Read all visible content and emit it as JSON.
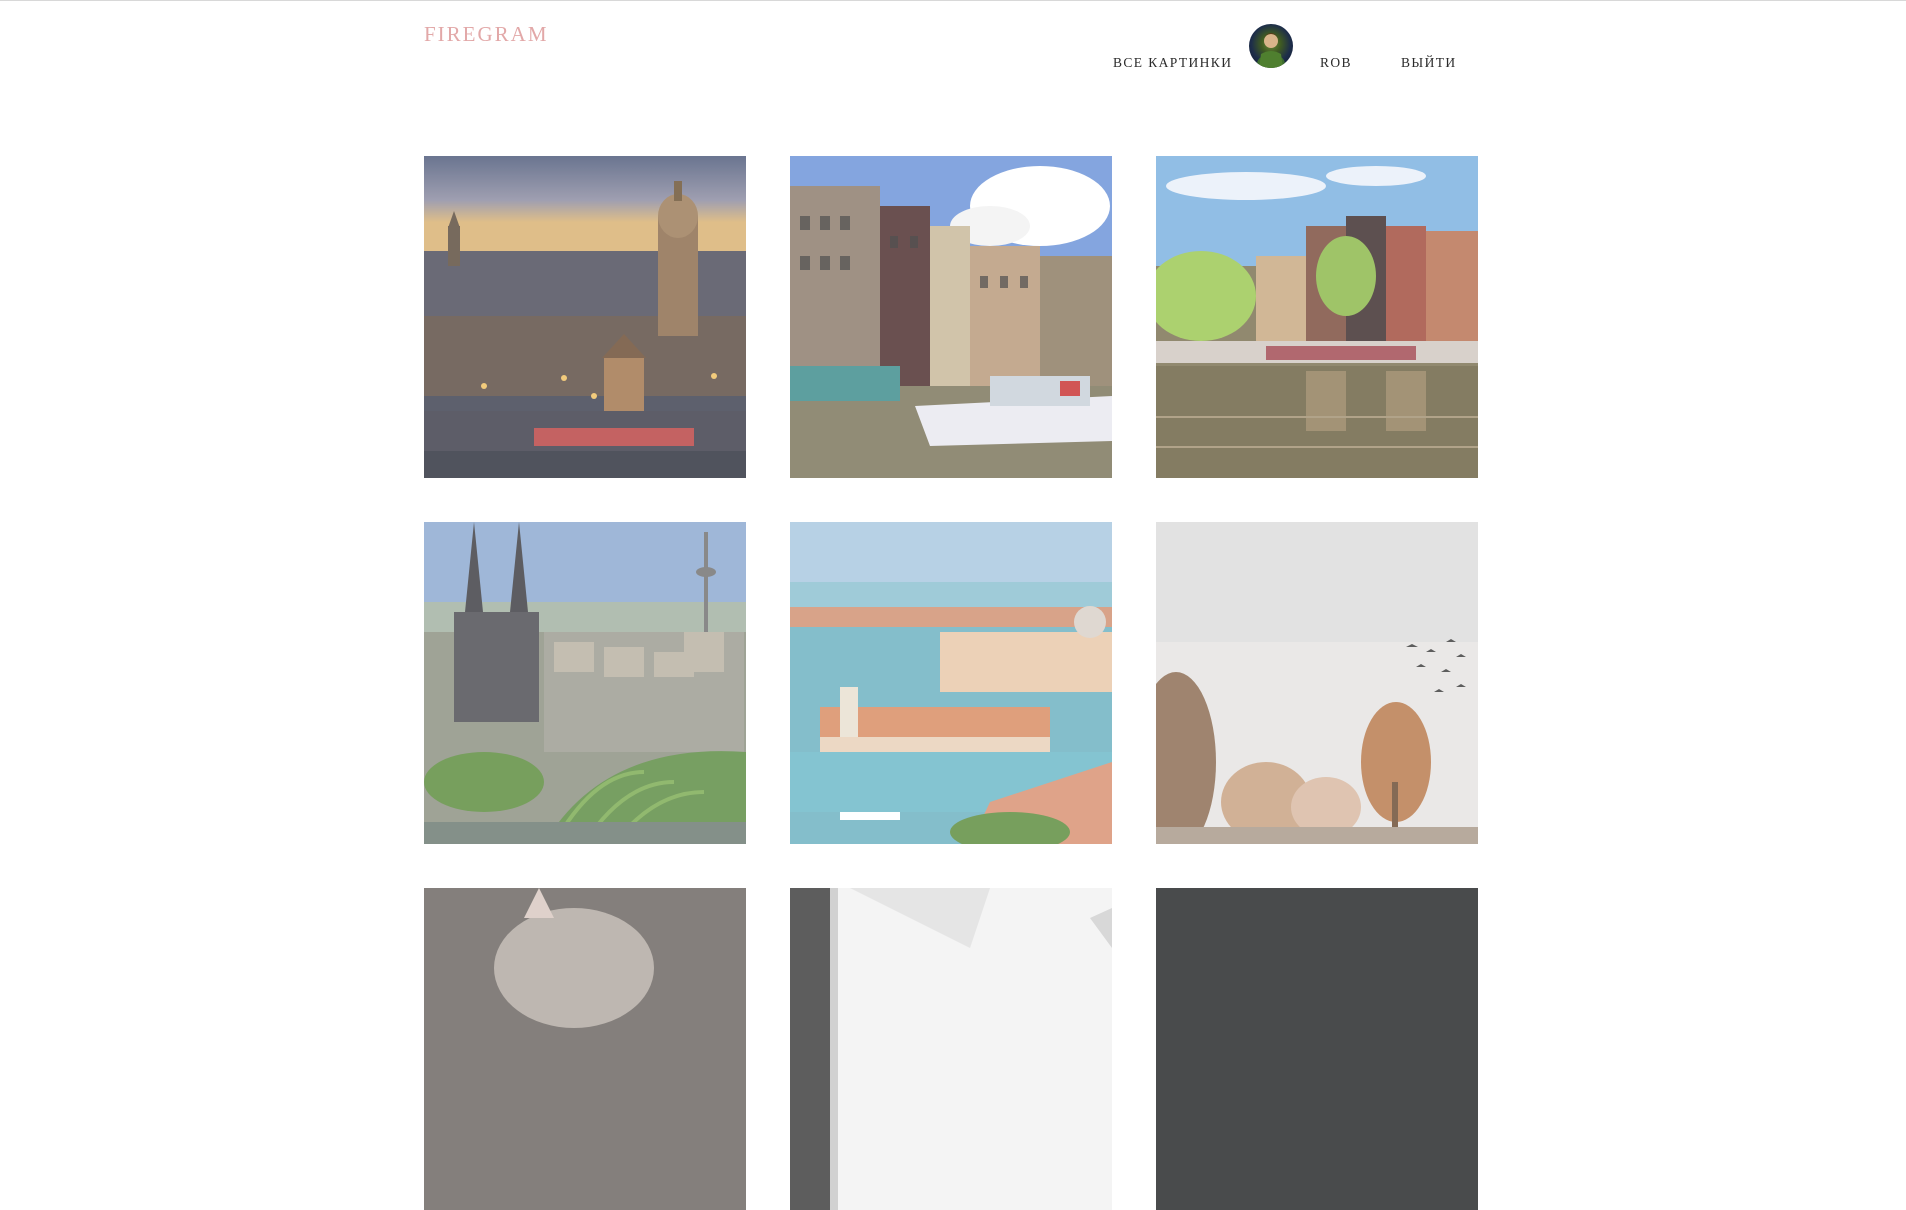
{
  "app": {
    "logo": "FIREGRAM"
  },
  "nav": {
    "all_pictures": "ВСЕ КАРТИНКИ",
    "username": "ROB",
    "logout": "ВЫЙТИ"
  },
  "gallery": {
    "items": [
      {
        "subject": "amsterdam-evening-cityscape"
      },
      {
        "subject": "amsterdam-canal-houses-boat"
      },
      {
        "subject": "amsterdam-canal-reflection"
      },
      {
        "subject": "cologne-cathedral-bridge"
      },
      {
        "subject": "venice-lagoon-aerial"
      },
      {
        "subject": "foggy-trees-birds"
      },
      {
        "subject": "cat-closeup"
      },
      {
        "subject": "white-architecture"
      },
      {
        "subject": "dark-photo"
      }
    ]
  },
  "colors": {
    "logo": "#e2a8a8",
    "nav_text": "#2b2b2b"
  }
}
